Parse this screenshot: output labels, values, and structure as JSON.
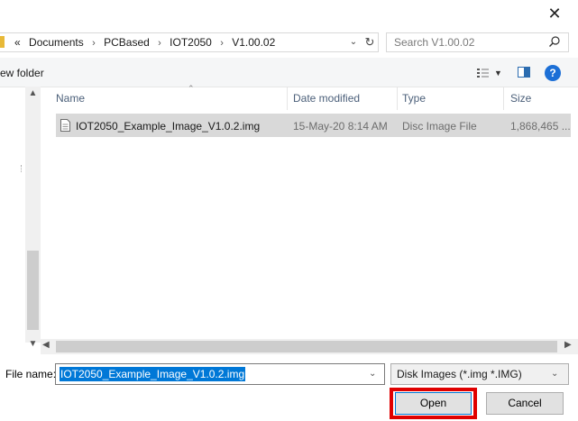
{
  "title_bar": {
    "close_glyph": "✕"
  },
  "address_bar": {
    "overflow": "«",
    "crumbs": [
      "Documents",
      "PCBased",
      "IOT2050",
      "V1.00.02"
    ],
    "separator": "›"
  },
  "search": {
    "placeholder": "Search V1.00.02",
    "icon": "search-icon"
  },
  "toolbar": {
    "new_folder_label": "ew folder",
    "help_label": "?"
  },
  "columns": {
    "name": "Name",
    "date": "Date modified",
    "type": "Type",
    "size": "Size"
  },
  "files": [
    {
      "name": "IOT2050_Example_Image_V1.0.2.img",
      "date": "15-May-20 8:14 AM",
      "type": "Disc Image File",
      "size": "1,868,465 ..."
    }
  ],
  "footer": {
    "file_name_label": "File name:",
    "file_name_value": "IOT2050_Example_Image_V1.0.2.img",
    "file_type_selected": "Disk Images (*.img *.IMG)",
    "open_label": "Open",
    "cancel_label": "Cancel"
  },
  "colors": {
    "accent": "#0078d7",
    "highlight_box": "#e00000",
    "help": "#1c6fd6",
    "selected_row": "#d9d9d9"
  }
}
